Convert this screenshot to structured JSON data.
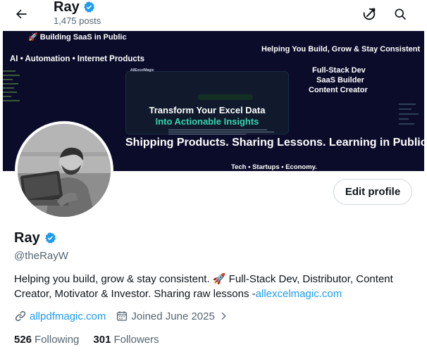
{
  "header": {
    "name": "Ray",
    "posts": "1,475 posts",
    "icons": {
      "back": "arrow-left-icon",
      "verified": "verified-badge-icon",
      "grok": "grok-icon",
      "search": "search-icon"
    }
  },
  "banner": {
    "line_saas": "🚀 Building SaaS in Public",
    "line_ai": "AI • Automation • Internet Products",
    "line_help": "Helping You Build, Grow & Stay Consistent",
    "line_fullstack": "Full-Stack Dev",
    "line_saas_builder": "SaaS Builder",
    "line_creator": "Content Creator",
    "card_logo": "AllExcelMagic",
    "card_title_1": "Transform Your Excel Data",
    "card_title_2": "Into Actionable Insights",
    "line_shipping": "Shipping Products. Sharing Lessons. Learning in Public",
    "line_tech": "Tech • Startups • Economy."
  },
  "profile": {
    "edit_label": "Edit profile",
    "display_name": "Ray",
    "handle": "@theRayW",
    "bio_text": "Helping you build, grow & stay consistent. 🚀 Full-Stack Dev, Distributor, Content Creator, Motivator & Investor. Sharing raw lessons -",
    "bio_link": "allexcelmagic.com",
    "website": "allpdfmagic.com",
    "joined": "Joined June 2025",
    "following_count": "526",
    "following_label": "Following",
    "followers_count": "301",
    "followers_label": "Followers"
  },
  "colors": {
    "accent": "#1d9bf0",
    "text": "#0f1419",
    "muted": "#536471",
    "banner_bg": "#0b0c2a",
    "highlight_teal": "#38d4b0"
  }
}
